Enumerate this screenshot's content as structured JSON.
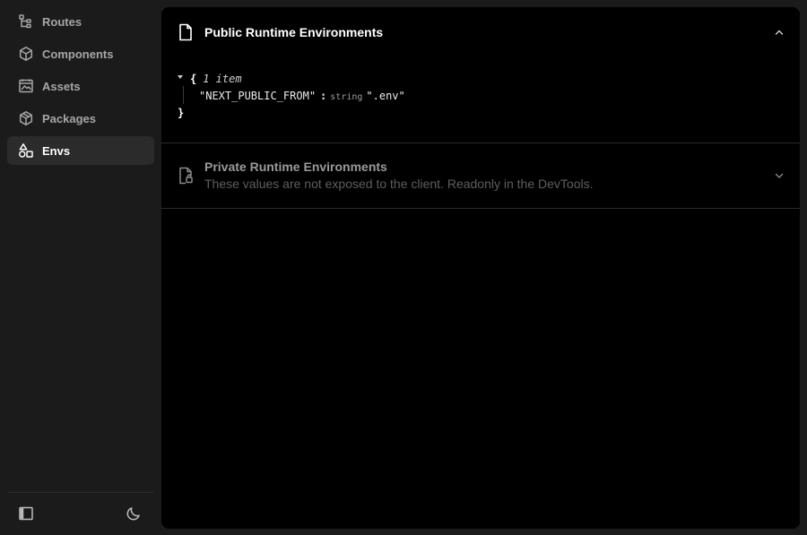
{
  "sidebar": {
    "items": [
      {
        "label": "Routes",
        "icon": "routes-tree-icon",
        "active": false
      },
      {
        "label": "Components",
        "icon": "component-cube-icon",
        "active": false
      },
      {
        "label": "Assets",
        "icon": "image-asset-icon",
        "active": false
      },
      {
        "label": "Packages",
        "icon": "package-box-icon",
        "active": false
      },
      {
        "label": "Envs",
        "icon": "shapes-icon",
        "active": true
      }
    ],
    "footer": {
      "toggle_icon": "sidebar-toggle-icon",
      "theme_icon": "moon-icon"
    }
  },
  "public_env": {
    "title": "Public Runtime Environments",
    "icon": "document-icon",
    "expanded": true,
    "json": {
      "open_brace": "{",
      "count": "1 item",
      "key": "\"NEXT_PUBLIC_FROM\"",
      "colon": ":",
      "type": "string",
      "value": "\".env\"",
      "close_brace": "}"
    }
  },
  "private_env": {
    "title": "Private Runtime Environments",
    "subtitle": "These values are not exposed to the client. Readonly in the DevTools.",
    "icon": "document-lock-icon",
    "expanded": false
  },
  "colors": {
    "background": "#1b1b1b",
    "panel": "#000000",
    "active_item": "#2b2b2b",
    "text_primary": "#ffffff",
    "text_muted": "#a6a6a6"
  }
}
